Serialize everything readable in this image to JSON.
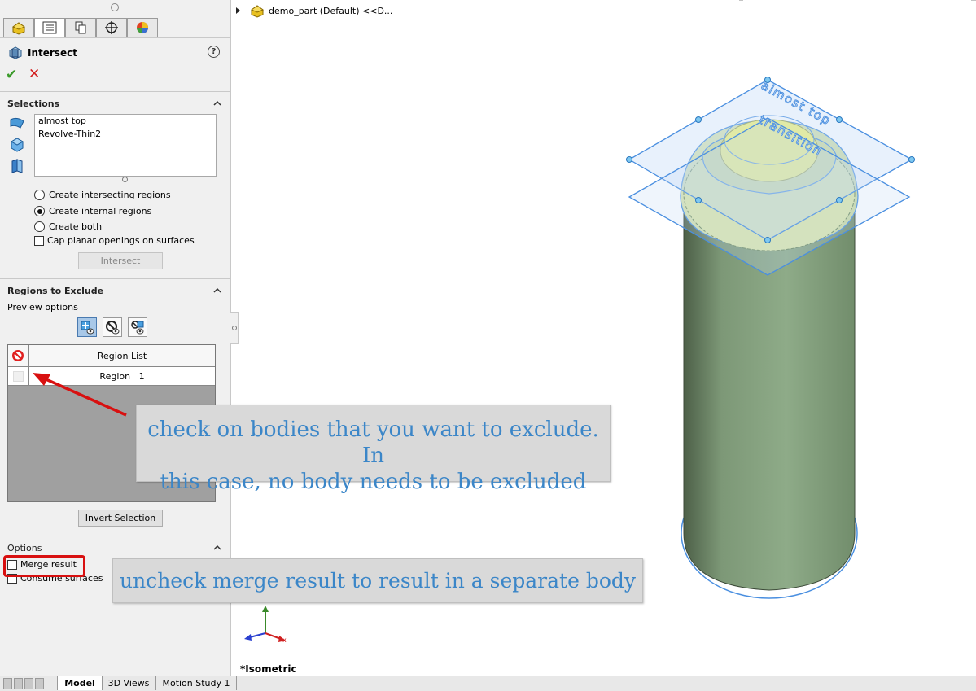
{
  "tree": {
    "item_label": "demo_part (Default) <<D..."
  },
  "feature": {
    "title": "Intersect",
    "help_symbol": "?",
    "ok_symbol": "✔",
    "cancel_symbol": "✕"
  },
  "selections": {
    "header": "Selections",
    "items": [
      "almost top",
      "Revolve-Thin2"
    ],
    "options": [
      {
        "label": "Create intersecting regions",
        "selected": false
      },
      {
        "label": "Create internal regions",
        "selected": true
      },
      {
        "label": "Create both",
        "selected": false
      }
    ],
    "cap_label": "Cap planar openings on surfaces",
    "intersect_button": "Intersect"
  },
  "regions": {
    "header": "Regions to Exclude",
    "preview_label": "Preview options",
    "column_header": "Region List",
    "rows": [
      "Region   1"
    ],
    "invert_button": "Invert Selection"
  },
  "options": {
    "header": "Options",
    "merge_label": "Merge result",
    "consume_label": "Consume surfaces"
  },
  "annotations": {
    "exclude_line1": "check on bodies that you want to exclude. In",
    "exclude_line2": "this case, no body needs to be excluded",
    "merge_note": "uncheck merge result to result in a separate body"
  },
  "viewport": {
    "plane_label_1": "almost top",
    "plane_label_2": "transition",
    "view_name": "*Isometric",
    "triad_x": "x"
  },
  "bottom_tabs": [
    {
      "label": "Model",
      "active": true
    },
    {
      "label": "3D Views",
      "active": false
    },
    {
      "label": "Motion Study 1",
      "active": false
    }
  ],
  "colors": {
    "accent_red": "#d81010",
    "annotation_text": "#3b86c8",
    "body_green": "#8aa585",
    "plane_blue": "#4a8fe0"
  }
}
